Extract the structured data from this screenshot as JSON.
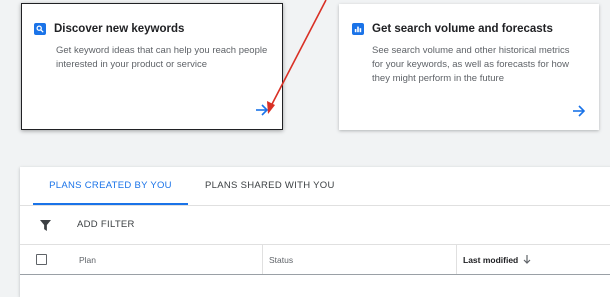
{
  "cards": [
    {
      "title": "Discover new keywords",
      "description": "Get keyword ideas that can help you reach people interested in your product or service",
      "icon": "search-icon"
    },
    {
      "title": "Get search volume and forecasts",
      "description": "See search volume and other historical metrics for your keywords, as well as forecasts for how they might perform in the future",
      "icon": "bar-chart-icon"
    }
  ],
  "tabs": [
    {
      "label": "PLANS CREATED BY YOU",
      "active": true
    },
    {
      "label": "PLANS SHARED WITH YOU",
      "active": false
    }
  ],
  "filter": {
    "label": "ADD FILTER"
  },
  "table": {
    "columns": [
      "Plan",
      "Status",
      "Last modified"
    ],
    "sorted_column": "Last modified",
    "sort": "descending"
  },
  "colors": {
    "accent": "#1a73e8",
    "annotation": "#d93025"
  }
}
